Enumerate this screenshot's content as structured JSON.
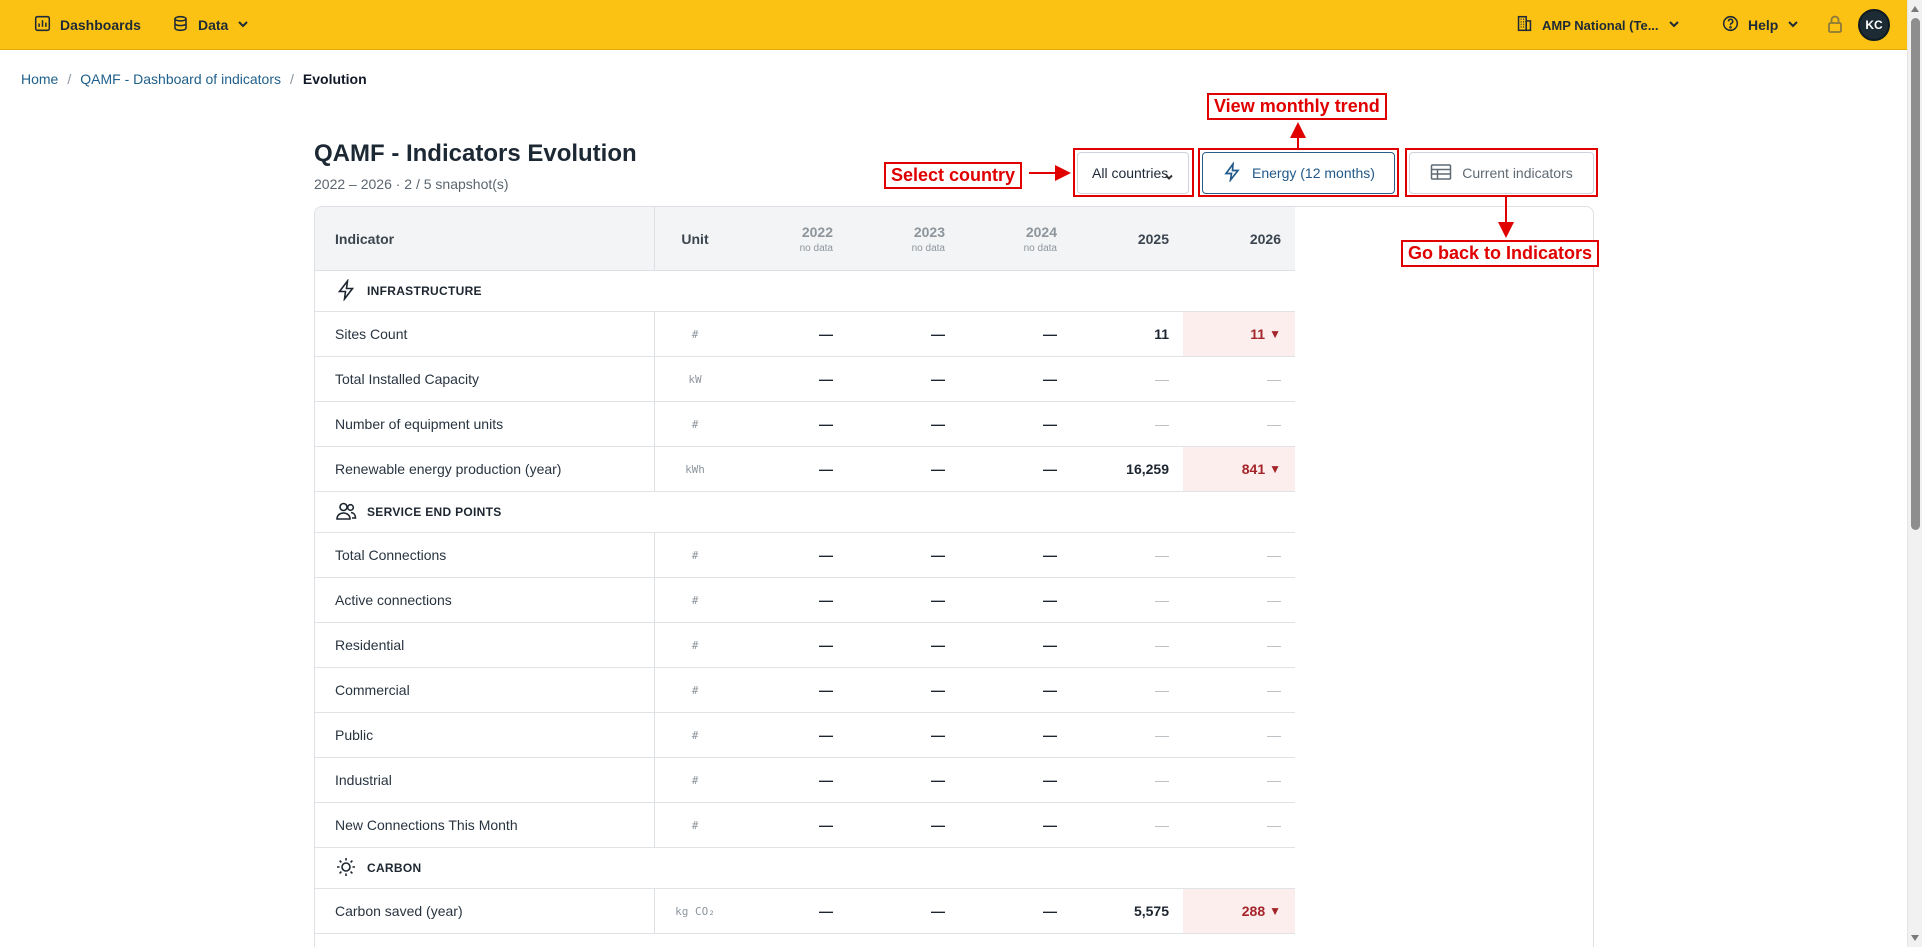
{
  "topbar": {
    "dashboards_label": "Dashboards",
    "data_label": "Data",
    "workspace_label": "AMP National (Te...",
    "help_label": "Help",
    "avatar_initials": "KC",
    "color": "#fcc213"
  },
  "breadcrumb": {
    "home": "Home",
    "parent": "QAMF - Dashboard of indicators",
    "current": "Evolution"
  },
  "page": {
    "title": "QAMF - Indicators Evolution",
    "subtitle": "2022 – 2026 · 2 / 5 snapshot(s)"
  },
  "controls": {
    "country_value": "All countries",
    "energy_button": "Energy (12 months)",
    "current_button": "Current indicators"
  },
  "annotations": {
    "select_country": "Select country",
    "view_monthly": "View monthly trend",
    "go_back": "Go back to Indicators",
    "color": "#e00000"
  },
  "table": {
    "headers": {
      "indicator": "Indicator",
      "unit": "Unit",
      "years": [
        {
          "year": "2022",
          "note": "no data"
        },
        {
          "year": "2023",
          "note": "no data"
        },
        {
          "year": "2024",
          "note": "no data"
        },
        {
          "year": "2025",
          "note": ""
        },
        {
          "year": "2026",
          "note": ""
        }
      ]
    },
    "sections": [
      {
        "name": "INFRASTRUCTURE",
        "icon": "lightning-icon",
        "rows": [
          {
            "label": "Sites Count",
            "unit": "#",
            "values": [
              "—",
              "—",
              "—",
              "11",
              "11"
            ]
          },
          {
            "label": "Total Installed Capacity",
            "unit": "kW",
            "values": [
              "—",
              "—",
              "—",
              "—",
              "—"
            ]
          },
          {
            "label": "Number of equipment units",
            "unit": "#",
            "values": [
              "—",
              "—",
              "—",
              "—",
              "—"
            ]
          },
          {
            "label": "Renewable energy production (year)",
            "unit": "kWh",
            "values": [
              "—",
              "—",
              "—",
              "16,259",
              "841"
            ]
          }
        ]
      },
      {
        "name": "SERVICE END POINTS",
        "icon": "users-icon",
        "rows": [
          {
            "label": "Total Connections",
            "unit": "#",
            "values": [
              "—",
              "—",
              "—",
              "—",
              "—"
            ]
          },
          {
            "label": "Active connections",
            "unit": "#",
            "values": [
              "—",
              "—",
              "—",
              "—",
              "—"
            ]
          },
          {
            "label": "Residential",
            "unit": "#",
            "values": [
              "—",
              "—",
              "—",
              "—",
              "—"
            ]
          },
          {
            "label": "Commercial",
            "unit": "#",
            "values": [
              "—",
              "—",
              "—",
              "—",
              "—"
            ]
          },
          {
            "label": "Public",
            "unit": "#",
            "values": [
              "—",
              "—",
              "—",
              "—",
              "—"
            ]
          },
          {
            "label": "Industrial",
            "unit": "#",
            "values": [
              "—",
              "—",
              "—",
              "—",
              "—"
            ]
          },
          {
            "label": "New Connections This Month",
            "unit": "#",
            "values": [
              "—",
              "—",
              "—",
              "—",
              "—"
            ]
          }
        ]
      },
      {
        "name": "CARBON",
        "icon": "sun-icon",
        "rows": [
          {
            "label": "Carbon saved (year)",
            "unit": "kg CO₂",
            "values": [
              "—",
              "—",
              "—",
              "5,575",
              "288"
            ]
          }
        ]
      }
    ],
    "decline_marker": "▼",
    "decline_color": "#a3252a"
  }
}
